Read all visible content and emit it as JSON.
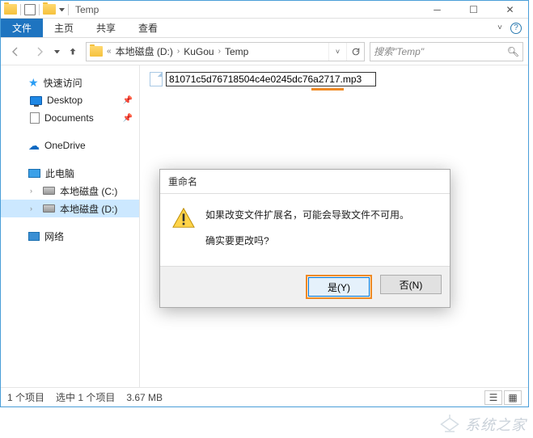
{
  "titlebar": {
    "title": "Temp"
  },
  "ribbon": {
    "file": "文件",
    "tabs": [
      "主页",
      "共享",
      "查看"
    ]
  },
  "address": {
    "crumbs": [
      "本地磁盘 (D:)",
      "KuGou",
      "Temp"
    ],
    "search_placeholder": "搜索\"Temp\""
  },
  "sidebar": {
    "quick": "快速访问",
    "quick_items": [
      "Desktop",
      "Documents"
    ],
    "onedrive": "OneDrive",
    "thispc": "此电脑",
    "drives": [
      "本地磁盘 (C:)",
      "本地磁盘 (D:)"
    ],
    "network": "网络"
  },
  "file": {
    "rename_value": "81071c5d76718504c4e0245dc76a2717.mp3"
  },
  "dialog": {
    "title": "重命名",
    "line1": "如果改变文件扩展名，可能会导致文件不可用。",
    "line2": "确实要更改吗?",
    "yes": "是(Y)",
    "no": "否(N)"
  },
  "status": {
    "items": "1 个项目",
    "selected": "选中 1 个项目",
    "size": "3.67 MB"
  },
  "watermark": "系统之家"
}
